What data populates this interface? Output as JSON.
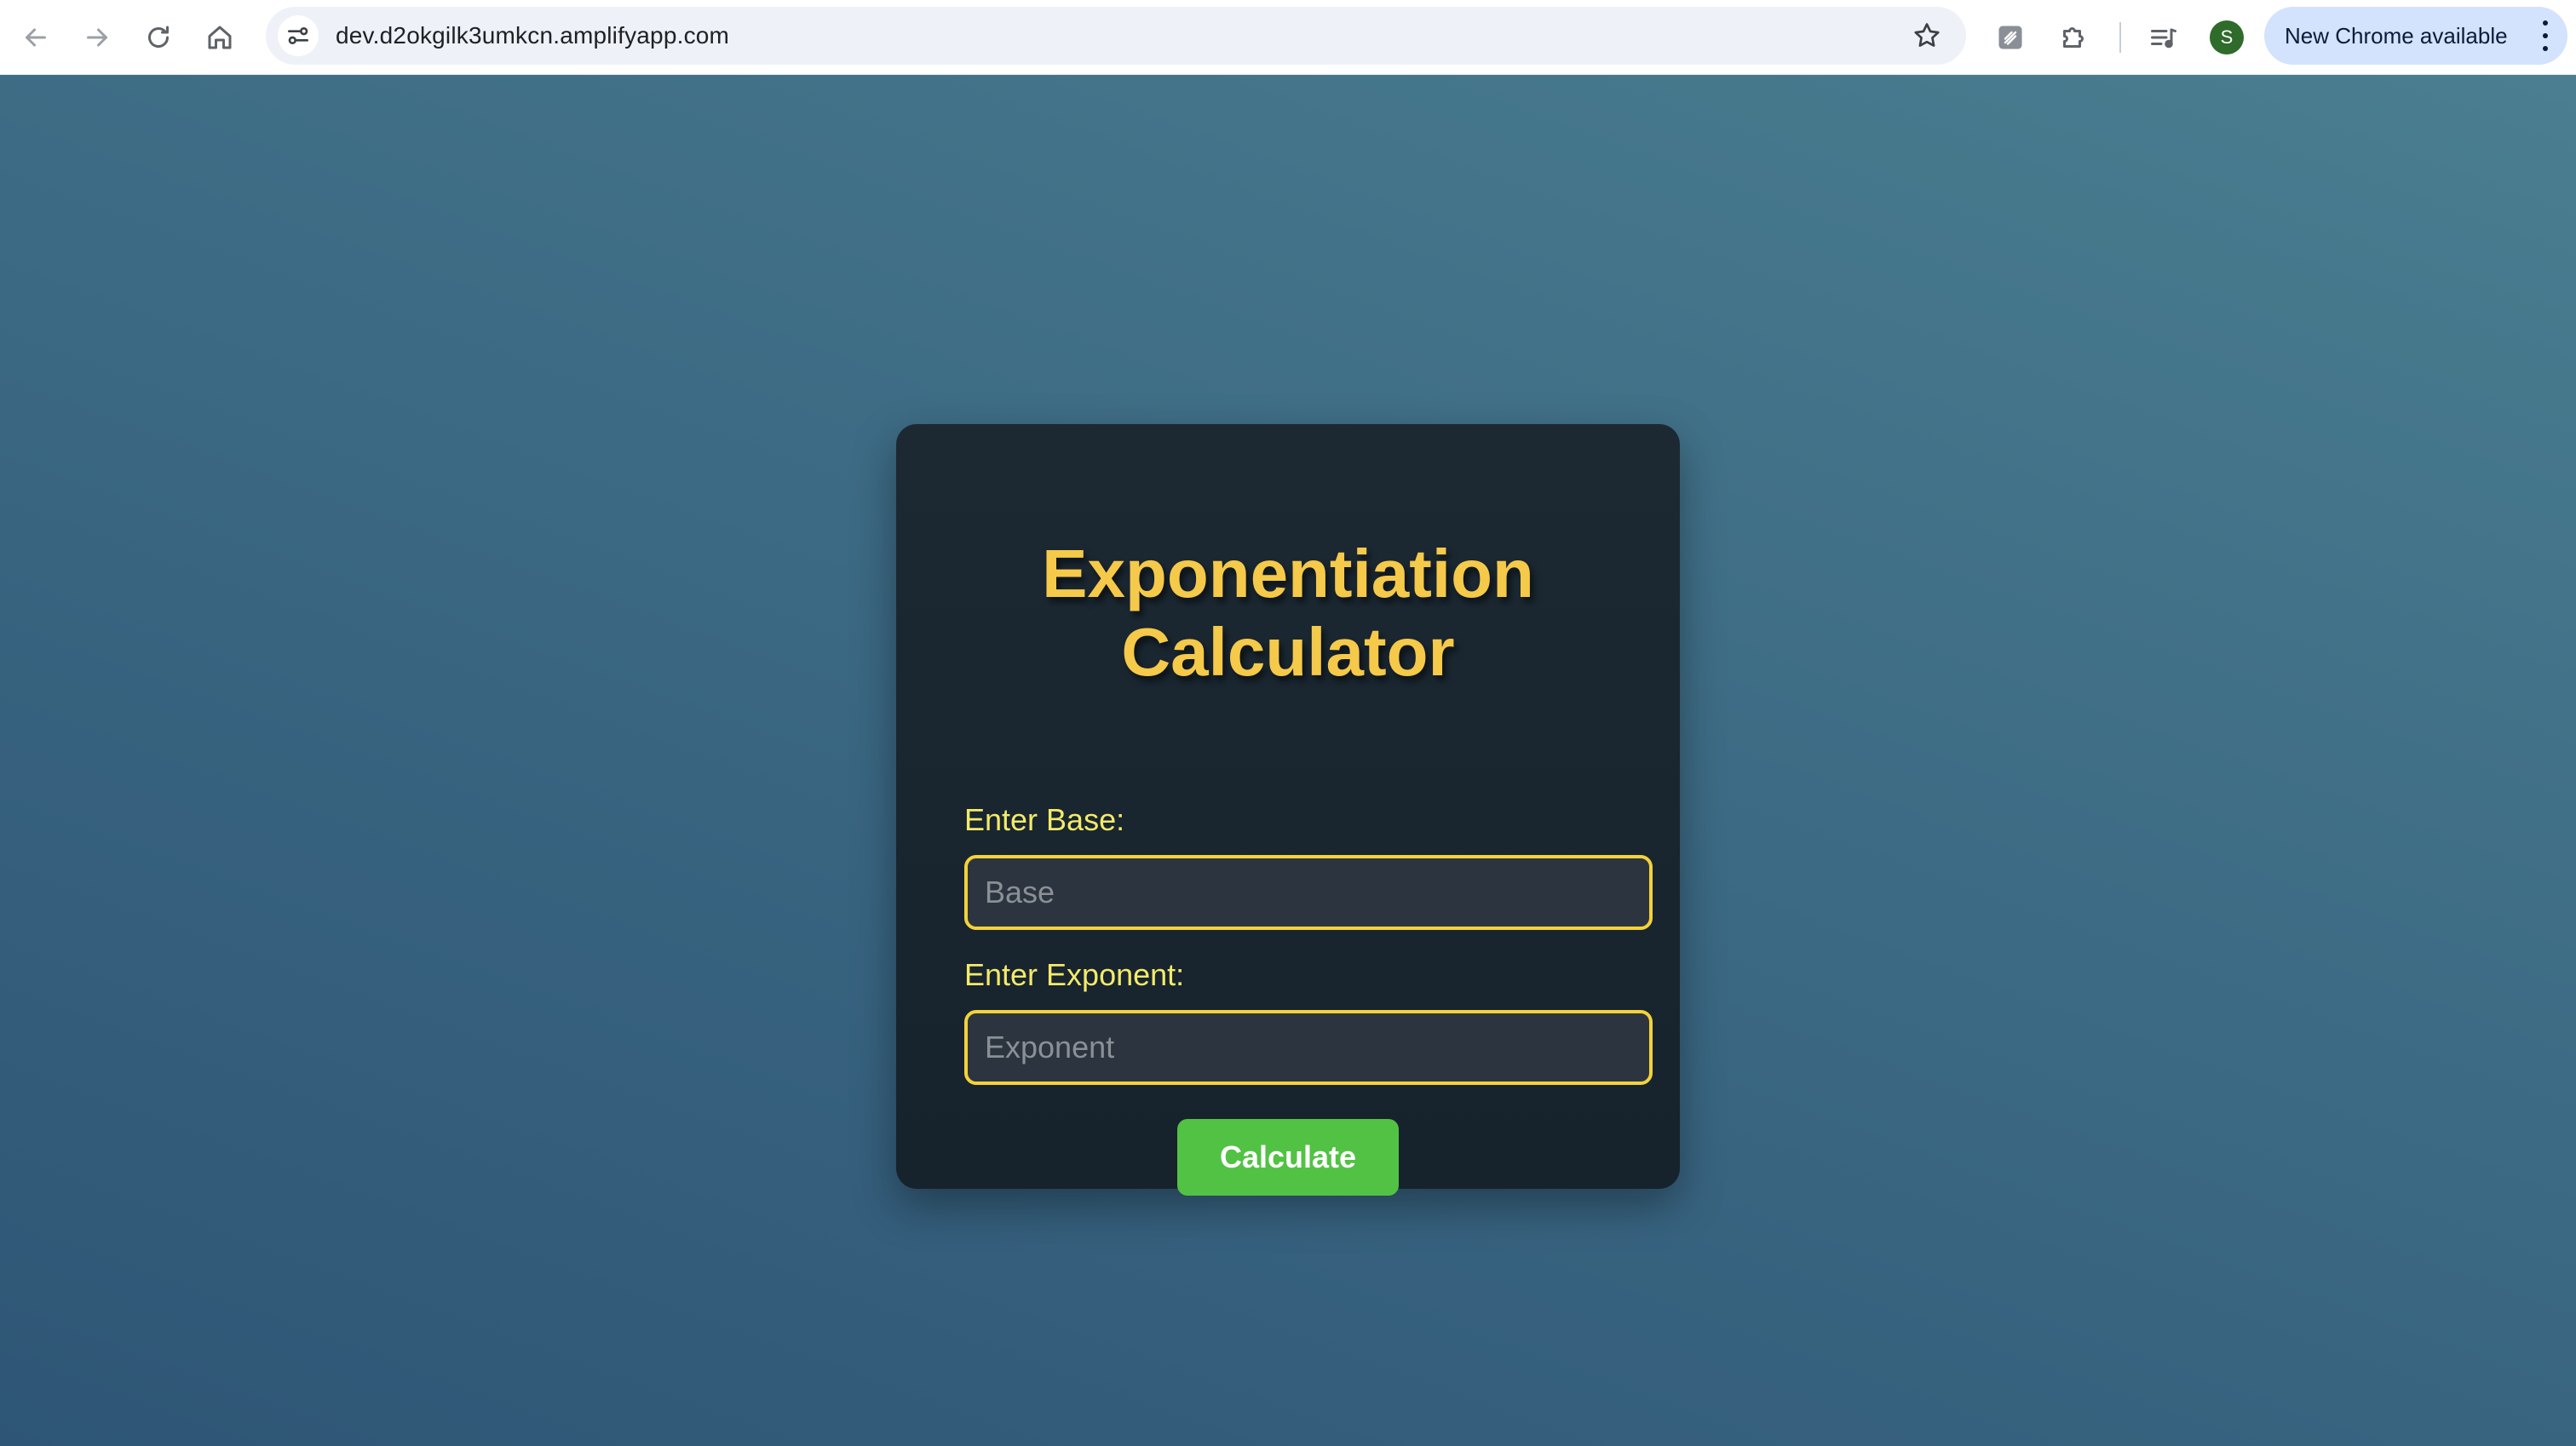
{
  "browser": {
    "url": "dev.d2okgilk3umkcn.amplifyapp.com",
    "avatar_letter": "S",
    "update_label": "New Chrome available",
    "icons": [
      "back-arrow-icon",
      "forward-arrow-icon",
      "reload-icon",
      "home-icon",
      "site-info-icon",
      "bookmark-star-icon",
      "extension-icon",
      "puzzle-extensions-icon",
      "media-controls-icon",
      "more-options-icon"
    ]
  },
  "calculator": {
    "title_line1": "Exponentiation",
    "title_line2": "Calculator",
    "base_label": "Enter Base:",
    "base_placeholder": "Base",
    "base_value": "",
    "exponent_label": "Enter Exponent:",
    "exponent_placeholder": "Exponent",
    "exponent_value": "",
    "calculate_label": "Calculate"
  },
  "colors": {
    "background_gradient_start": "#2e5575",
    "background_gradient_end": "#4a7e90",
    "card_bg": "#1b2731",
    "title": "#f5c94a",
    "label": "#f3ea6a",
    "input_border": "#f3d23a",
    "button": "#52c245"
  }
}
